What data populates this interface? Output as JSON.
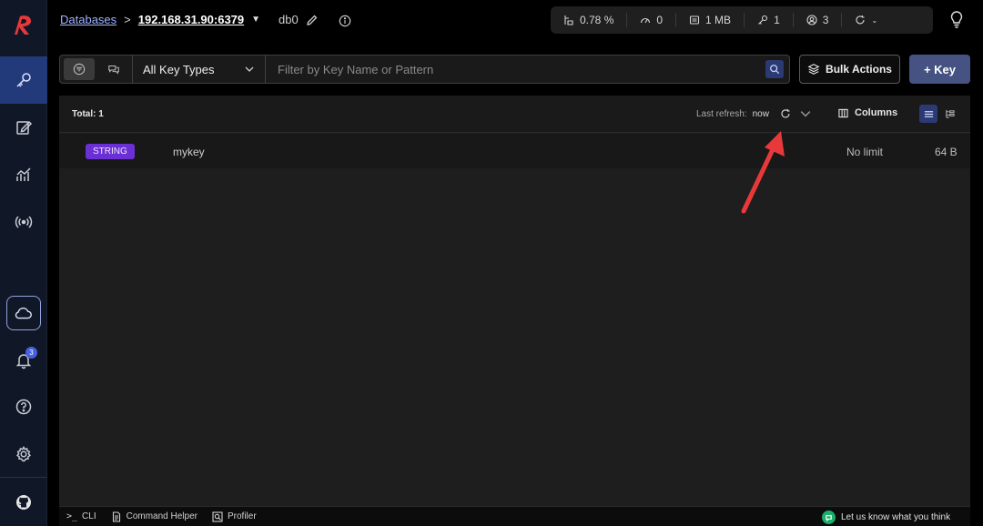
{
  "breadcrumb": {
    "databases_label": "Databases",
    "separator": ">",
    "host": "192.168.31.90:6379",
    "db": "db0"
  },
  "stats": [
    {
      "icon": "cpu-icon",
      "value": "0.78 %"
    },
    {
      "icon": "gauge-icon",
      "value": "0"
    },
    {
      "icon": "memory-icon",
      "value": "1 MB"
    },
    {
      "icon": "key-icon",
      "value": "1"
    },
    {
      "icon": "user-icon",
      "value": "3"
    }
  ],
  "sidebar": {
    "notification_count": "3"
  },
  "filter": {
    "key_type_label": "All Key Types",
    "search_placeholder": "Filter by Key Name or Pattern"
  },
  "actions": {
    "bulk_label": "Bulk Actions",
    "add_key_label": "+ Key"
  },
  "list": {
    "total_label": "Total: 1",
    "last_refresh_label": "Last refresh:",
    "last_refresh_value": "now",
    "columns_label": "Columns",
    "rows": [
      {
        "type": "STRING",
        "name": "mykey",
        "ttl": "No limit",
        "size": "64 B"
      }
    ]
  },
  "bottom": {
    "cli_label": "CLI",
    "helper_label": "Command Helper",
    "profiler_label": "Profiler",
    "feedback_label": "Let us know what you think"
  },
  "colors": {
    "accent": "#465282",
    "string_badge": "#6b2fd6",
    "annotation_arrow": "#e8393a",
    "logo": "#e8393a"
  }
}
